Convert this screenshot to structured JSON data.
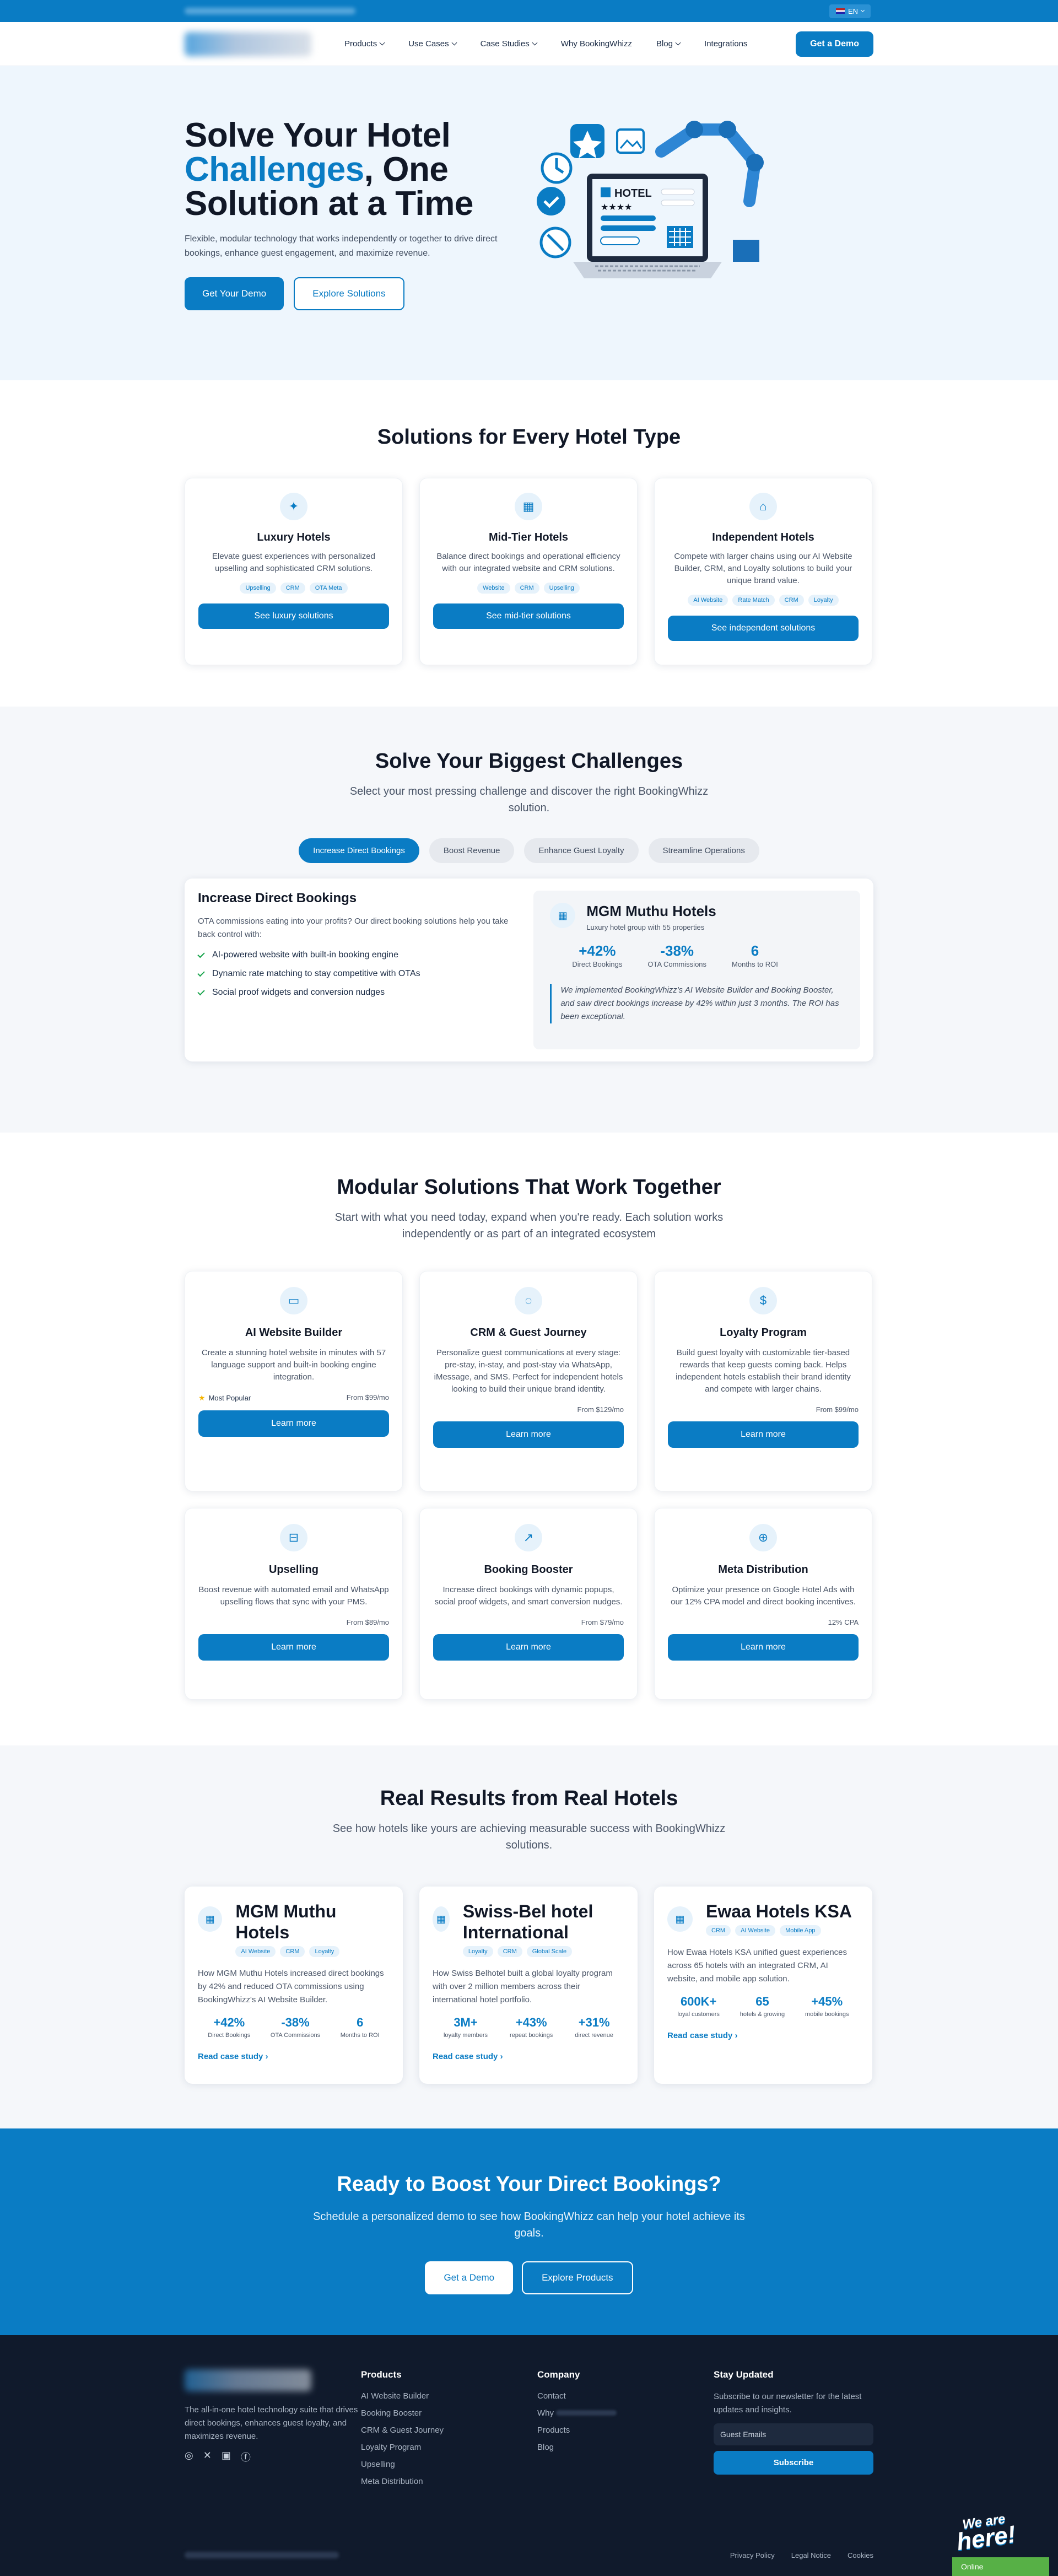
{
  "topbar": {
    "lang": "EN"
  },
  "nav": {
    "items": [
      "Products",
      "Use Cases",
      "Case Studies",
      "Why BookingWhizz",
      "Blog",
      "Integrations"
    ],
    "cta": "Get a Demo"
  },
  "hero": {
    "line1": "Solve Your Hotel",
    "accent": "Challenges",
    "line2_rest": ", One",
    "line3": "Solution at a Time",
    "desc": "Flexible, modular technology that works independently or together to drive direct bookings, enhance guest engagement, and maximize revenue.",
    "btn_demo": "Get Your Demo",
    "btn_explore": "Explore Solutions",
    "art_label": "HOTEL"
  },
  "types": {
    "title": "Solutions for Every Hotel Type",
    "cards": [
      {
        "title": "Luxury Hotels",
        "desc": "Elevate guest experiences with personalized upselling and sophisticated CRM solutions.",
        "tags": [
          "Upselling",
          "CRM",
          "OTA Meta"
        ],
        "btn": "See luxury solutions"
      },
      {
        "title": "Mid-Tier Hotels",
        "desc": "Balance direct bookings and operational efficiency with our integrated website and CRM solutions.",
        "tags": [
          "Website",
          "CRM",
          "Upselling"
        ],
        "btn": "See mid-tier solutions"
      },
      {
        "title": "Independent Hotels",
        "desc": "Compete with larger chains using our AI Website Builder, CRM, and Loyalty solutions to build your unique brand value.",
        "tags": [
          "AI Website",
          "Rate Match",
          "CRM",
          "Loyalty"
        ],
        "btn": "See independent solutions"
      }
    ]
  },
  "challenges": {
    "title": "Solve Your Biggest Challenges",
    "subtitle": "Select your most pressing challenge and discover the right BookingWhizz solution.",
    "tabs": [
      "Increase Direct Bookings",
      "Boost Revenue",
      "Enhance Guest Loyalty",
      "Streamline Operations"
    ],
    "panel": {
      "title": "Increase Direct Bookings",
      "desc": "OTA commissions eating into your profits? Our direct booking solutions help you take back control with:",
      "items": [
        "AI-powered website with built-in booking engine",
        "Dynamic rate matching to stay competitive with OTAs",
        "Social proof widgets and conversion nudges"
      ]
    },
    "case": {
      "name": "MGM Muthu Hotels",
      "meta": "Luxury hotel group with 55 properties",
      "stats": [
        {
          "v": "+42%",
          "l": "Direct Bookings"
        },
        {
          "v": "-38%",
          "l": "OTA Commissions"
        },
        {
          "v": "6",
          "l": "Months to ROI"
        }
      ],
      "quote": "We implemented BookingWhizz's AI Website Builder and Booking Booster, and saw direct bookings increase by 42% within just 3 months. The ROI has been exceptional."
    }
  },
  "modular": {
    "title": "Modular Solutions That Work Together",
    "subtitle": "Start with what you need today, expand when you're ready. Each solution works independently or as part of an integrated ecosystem",
    "cards": [
      {
        "title": "AI Website Builder",
        "desc": "Create a stunning hotel website in minutes with 57 language support and built-in booking engine integration.",
        "popular": "Most Popular",
        "price": "From $99/mo",
        "btn": "Learn more",
        "icon": "monitor-icon"
      },
      {
        "title": "CRM & Guest Journey",
        "desc": "Personalize guest communications at every stage: pre-stay, in-stay, and post-stay via WhatsApp, iMessage, and SMS. Perfect for independent hotels looking to build their unique brand identity.",
        "price": "From $129/mo",
        "btn": "Learn more",
        "icon": "chat-icon"
      },
      {
        "title": "Loyalty Program",
        "desc": "Build guest loyalty with customizable tier-based rewards that keep guests coming back. Helps independent hotels establish their brand identity and compete with larger chains.",
        "price": "From $99/mo",
        "btn": "Learn more",
        "icon": "dollar-icon"
      },
      {
        "title": "Upselling",
        "desc": "Boost revenue with automated email and WhatsApp upselling flows that sync with your PMS.",
        "price": "From $89/mo",
        "btn": "Learn more",
        "icon": "bag-icon"
      },
      {
        "title": "Booking Booster",
        "desc": "Increase direct bookings with dynamic popups, social proof widgets, and smart conversion nudges.",
        "price": "From $79/mo",
        "btn": "Learn more",
        "icon": "trend-icon"
      },
      {
        "title": "Meta Distribution",
        "desc": "Optimize your presence on Google Hotel Ads with our 12% CPA model and direct booking incentives.",
        "price": "12% CPA",
        "btn": "Learn more",
        "icon": "globe-icon"
      }
    ]
  },
  "results": {
    "title": "Real Results from Real Hotels",
    "subtitle": "See how hotels like yours are achieving measurable success with BookingWhizz solutions.",
    "cards": [
      {
        "name": "MGM Muthu Hotels",
        "tags": [
          "AI Website",
          "CRM",
          "Loyalty"
        ],
        "desc": "How MGM Muthu Hotels increased direct bookings by 42% and reduced OTA commissions using BookingWhizz's AI Website Builder.",
        "stats": [
          {
            "v": "+42%",
            "l": "Direct Bookings"
          },
          {
            "v": "-38%",
            "l": "OTA Commissions"
          },
          {
            "v": "6",
            "l": "Months to ROI"
          }
        ],
        "link": "Read case study"
      },
      {
        "name": "Swiss-Bel hotel International",
        "tags": [
          "Loyalty",
          "CRM",
          "Global Scale"
        ],
        "desc": "How Swiss Belhotel built a global loyalty program with over 2 million members across their international hotel portfolio.",
        "stats": [
          {
            "v": "3M+",
            "l": "loyalty members"
          },
          {
            "v": "+43%",
            "l": "repeat bookings"
          },
          {
            "v": "+31%",
            "l": "direct revenue"
          }
        ],
        "link": "Read case study"
      },
      {
        "name": "Ewaa Hotels KSA",
        "tags": [
          "CRM",
          "AI Website",
          "Mobile App"
        ],
        "desc": "How Ewaa Hotels KSA unified guest experiences across 65 hotels with an integrated CRM, AI website, and mobile app solution.",
        "stats": [
          {
            "v": "600K+",
            "l": "loyal customers"
          },
          {
            "v": "65",
            "l": "hotels & growing"
          },
          {
            "v": "+45%",
            "l": "mobile bookings"
          }
        ],
        "link": "Read case study"
      }
    ]
  },
  "cta": {
    "title": "Ready to Boost Your Direct Bookings?",
    "desc": "Schedule a personalized demo to see how BookingWhizz can help your hotel achieve its goals.",
    "btn1": "Get a Demo",
    "btn2": "Explore Products"
  },
  "footer": {
    "about": "The all-in-one hotel technology suite that drives direct bookings, enhances guest loyalty, and maximizes revenue.",
    "products_title": "Products",
    "products": [
      "AI Website Builder",
      "Booking Booster",
      "CRM & Guest Journey",
      "Loyalty Program",
      "Upselling",
      "Meta Distribution"
    ],
    "company_title": "Company",
    "company": [
      "Contact",
      "Why",
      "Products",
      "Blog"
    ],
    "news_title": "Stay Updated",
    "news_desc": "Subscribe to our newsletter for the latest updates and insights.",
    "email_placeholder": "Guest Emails",
    "subscribe": "Subscribe",
    "links": [
      "Privacy Policy",
      "Legal Notice",
      "Cookies"
    ],
    "badge1": "We are",
    "badge2": "here!",
    "online": "Online"
  }
}
